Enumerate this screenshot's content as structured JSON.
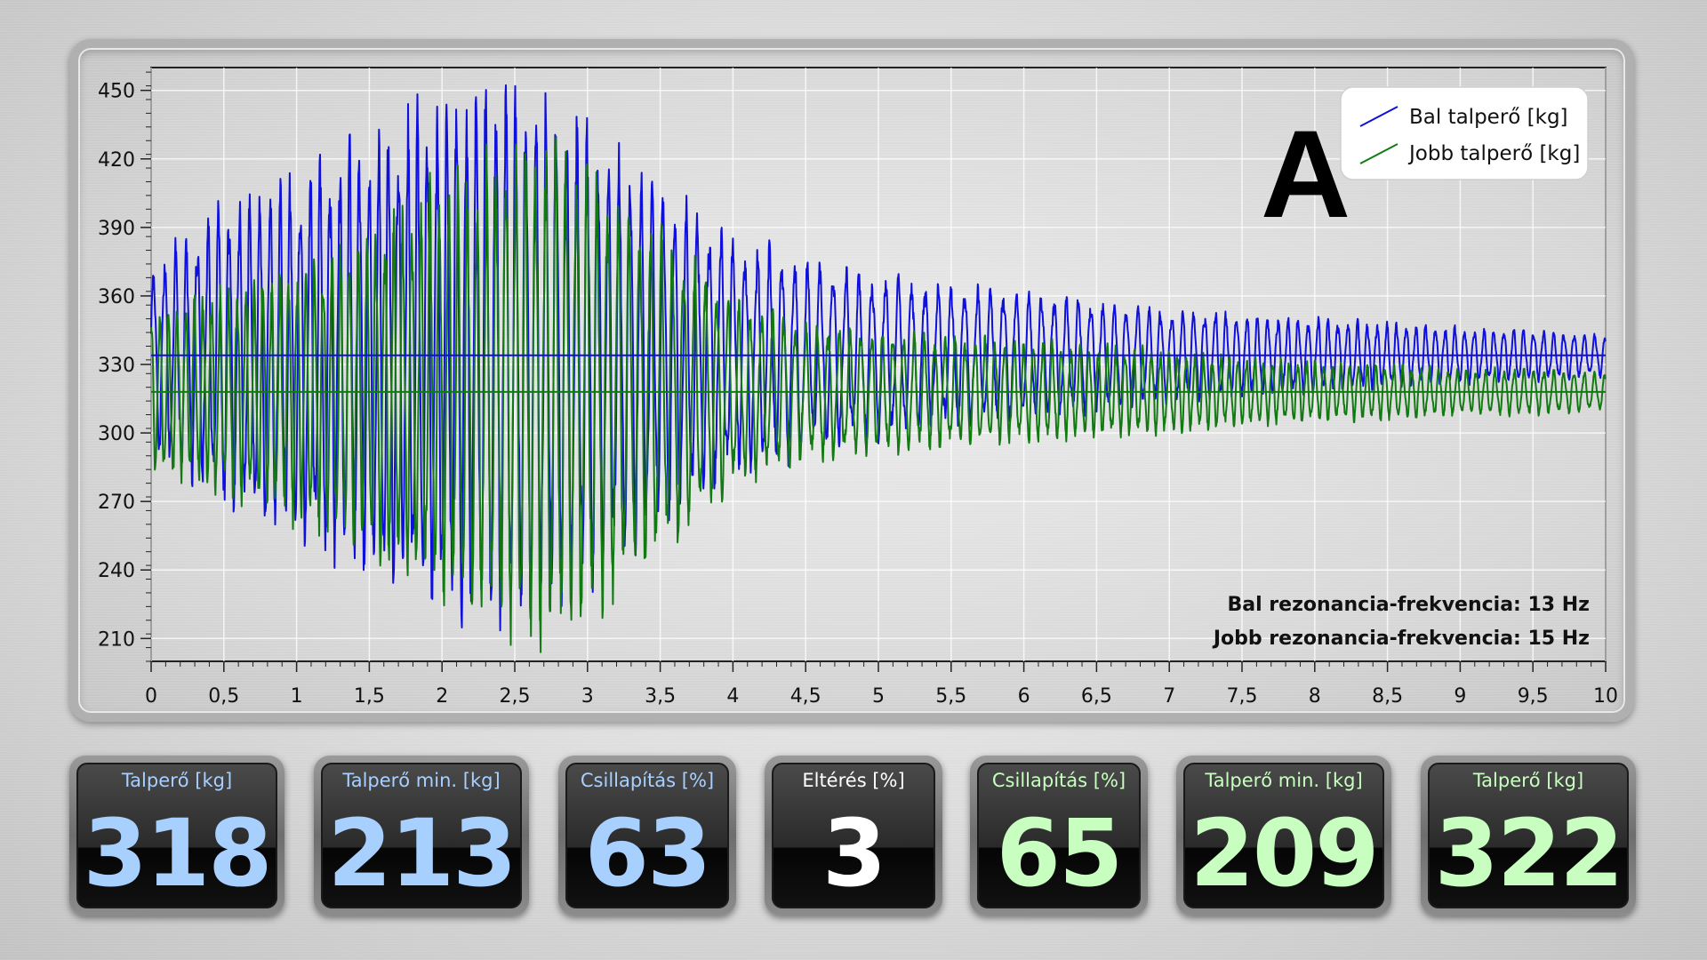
{
  "chart_data": {
    "type": "line",
    "title": "A",
    "xlabel": "",
    "ylabel": "",
    "xlim": [
      0,
      10
    ],
    "ylim": [
      200,
      460
    ],
    "x_ticks": [
      0,
      0.5,
      1,
      1.5,
      2,
      2.5,
      3,
      3.5,
      4,
      4.5,
      5,
      5.5,
      6,
      6.5,
      7,
      7.5,
      8,
      8.5,
      9,
      9.5,
      10
    ],
    "x_tick_labels": [
      "0",
      "0,5",
      "1",
      "1,5",
      "2",
      "2,5",
      "3",
      "3,5",
      "4",
      "4,5",
      "5",
      "5,5",
      "6",
      "6,5",
      "7",
      "7,5",
      "8",
      "8,5",
      "9",
      "9,5",
      "10"
    ],
    "y_ticks": [
      210,
      240,
      270,
      300,
      330,
      360,
      390,
      420,
      450
    ],
    "y_tick_labels": [
      "210",
      "240",
      "270",
      "300",
      "330",
      "360",
      "390",
      "420",
      "450"
    ],
    "grid": true,
    "legend_position": "top-right",
    "series": [
      {
        "name": "Bal talperő [kg]",
        "color": "#1010dd",
        "mean": 334,
        "freq_hz": 13,
        "x": [
          0,
          0.5,
          1,
          1.5,
          2,
          2.3,
          2.5,
          3,
          3.5,
          4,
          4.5,
          5,
          5.5,
          6,
          6.5,
          7,
          7.5,
          8,
          8.5,
          9,
          9.5,
          10
        ],
        "amplitude": [
          40,
          65,
          80,
          95,
          110,
          120,
          116,
          100,
          75,
          50,
          42,
          35,
          30,
          28,
          24,
          20,
          18,
          16,
          14,
          12,
          11,
          9
        ]
      },
      {
        "name": "Jobb talperő [kg]",
        "color": "#137a13",
        "mean": 318,
        "freq_hz": 15,
        "x": [
          0,
          0.5,
          1,
          1.5,
          2,
          2.5,
          2.8,
          3,
          3.5,
          4,
          4.5,
          5,
          5.5,
          6,
          6.5,
          7,
          7.5,
          8,
          8.5,
          9,
          9.5,
          10
        ],
        "amplitude": [
          35,
          45,
          55,
          70,
          90,
          105,
          108,
          100,
          70,
          40,
          30,
          26,
          24,
          22,
          20,
          18,
          15,
          13,
          12,
          10,
          10,
          8
        ]
      }
    ],
    "mean_lines": [
      334,
      318
    ],
    "annotations": [
      "Bal rezonancia-frekvencia: 13 Hz",
      "Jobb rezonancia-frekvencia: 15 Hz"
    ]
  },
  "colors": {
    "blue_value": "#a8d0ff",
    "white_value": "#ffffff",
    "green_value": "#c8ffc0"
  },
  "panels": [
    {
      "label": "Talperő [kg]",
      "value": "318",
      "tone": "blue"
    },
    {
      "label": "Talperő min. [kg]",
      "value": "213",
      "tone": "blue"
    },
    {
      "label": "Csillapítás [%]",
      "value": "63",
      "tone": "blue"
    },
    {
      "label": "Eltérés [%]",
      "value": "3",
      "tone": "white"
    },
    {
      "label": "Csillapítás [%]",
      "value": "65",
      "tone": "green"
    },
    {
      "label": "Talperő min. [kg]",
      "value": "209",
      "tone": "green"
    },
    {
      "label": "Talperő [kg]",
      "value": "322",
      "tone": "green"
    }
  ]
}
